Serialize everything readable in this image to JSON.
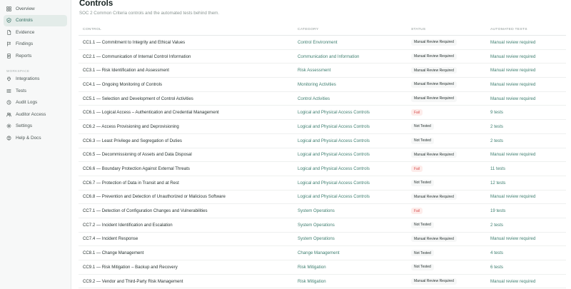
{
  "sidebar": {
    "items_top": [
      {
        "label": "Overview",
        "icon": "grid-icon"
      },
      {
        "label": "Controls",
        "icon": "shield-check-icon",
        "active": true
      },
      {
        "label": "Evidence",
        "icon": "file-icon"
      },
      {
        "label": "Findings",
        "icon": "flag-icon"
      },
      {
        "label": "Reports",
        "icon": "document-icon"
      }
    ],
    "section_label": "WORKSPACE",
    "items_bottom": [
      {
        "label": "Integrations",
        "icon": "plug-icon"
      },
      {
        "label": "Tests",
        "icon": "list-icon"
      },
      {
        "label": "Audit Logs",
        "icon": "history-icon"
      },
      {
        "label": "Auditor Access",
        "icon": "users-icon"
      },
      {
        "label": "Settings",
        "icon": "gear-icon"
      },
      {
        "label": "Help & Docs",
        "icon": "help-icon"
      }
    ]
  },
  "header": {
    "title": "Controls",
    "subtitle": "SOC 2 Common Criteria controls and the automated tests behind them."
  },
  "table": {
    "columns": [
      "CONTROL",
      "CATEGORY",
      "STATUS",
      "AUTOMATED TESTS"
    ],
    "rows": [
      {
        "control": "CC1.1 — Commitment to Integrity and Ethical Values",
        "category": "Control Environment",
        "status": "Manual Review Required",
        "tests": "Manual review required"
      },
      {
        "control": "CC2.1 — Communication of Internal Control Information",
        "category": "Communication and Information",
        "status": "Manual Review Required",
        "tests": "Manual review required"
      },
      {
        "control": "CC3.1 — Risk Identification and Assessment",
        "category": "Risk Assessment",
        "status": "Manual Review Required",
        "tests": "Manual review required"
      },
      {
        "control": "CC4.1 — Ongoing Monitoring of Controls",
        "category": "Monitoring Activities",
        "status": "Manual Review Required",
        "tests": "Manual review required"
      },
      {
        "control": "CC5.1 — Selection and Development of Control Activities",
        "category": "Control Activities",
        "status": "Manual Review Required",
        "tests": "Manual review required"
      },
      {
        "control": "CC6.1 — Logical Access – Authentication and Credential Management",
        "category": "Logical and Physical Access Controls",
        "status": "Fail",
        "tests": "9 tests"
      },
      {
        "control": "CC6.2 — Access Provisioning and Deprovisioning",
        "category": "Logical and Physical Access Controls",
        "status": "Not Tested",
        "tests": "2 tests"
      },
      {
        "control": "CC6.3 — Least Privilege and Segregation of Duties",
        "category": "Logical and Physical Access Controls",
        "status": "Not Tested",
        "tests": "2 tests"
      },
      {
        "control": "CC6.5 — Decommissioning of Assets and Data Disposal",
        "category": "Logical and Physical Access Controls",
        "status": "Manual Review Required",
        "tests": "Manual review required"
      },
      {
        "control": "CC6.6 — Boundary Protection Against External Threats",
        "category": "Logical and Physical Access Controls",
        "status": "Fail",
        "tests": "11 tests"
      },
      {
        "control": "CC6.7 — Protection of Data in Transit and at Rest",
        "category": "Logical and Physical Access Controls",
        "status": "Not Tested",
        "tests": "12 tests"
      },
      {
        "control": "CC6.8 — Prevention and Detection of Unauthorized or Malicious Software",
        "category": "Logical and Physical Access Controls",
        "status": "Manual Review Required",
        "tests": "Manual review required"
      },
      {
        "control": "CC7.1 — Detection of Configuration Changes and Vulnerabilities",
        "category": "System Operations",
        "status": "Fail",
        "tests": "19 tests"
      },
      {
        "control": "CC7.2 — Incident Identification and Escalation",
        "category": "System Operations",
        "status": "Not Tested",
        "tests": "2 tests"
      },
      {
        "control": "CC7.4 — Incident Response",
        "category": "System Operations",
        "status": "Manual Review Required",
        "tests": "Manual review required"
      },
      {
        "control": "CC8.1 — Change Management",
        "category": "Change Management",
        "status": "Not Tested",
        "tests": "4 tests"
      },
      {
        "control": "CC9.1 — Risk Mitigation – Backup and Recovery",
        "category": "Risk Mitigation",
        "status": "Not Tested",
        "tests": "6 tests"
      },
      {
        "control": "CC9.2 — Vendor and Third-Party Risk Management",
        "category": "Risk Mitigation",
        "status": "Manual Review Required",
        "tests": "Manual review required"
      }
    ]
  },
  "colors": {
    "accent": "#3f7f70",
    "fail": "#d94e4e",
    "active_bg": "#e3ece9"
  }
}
